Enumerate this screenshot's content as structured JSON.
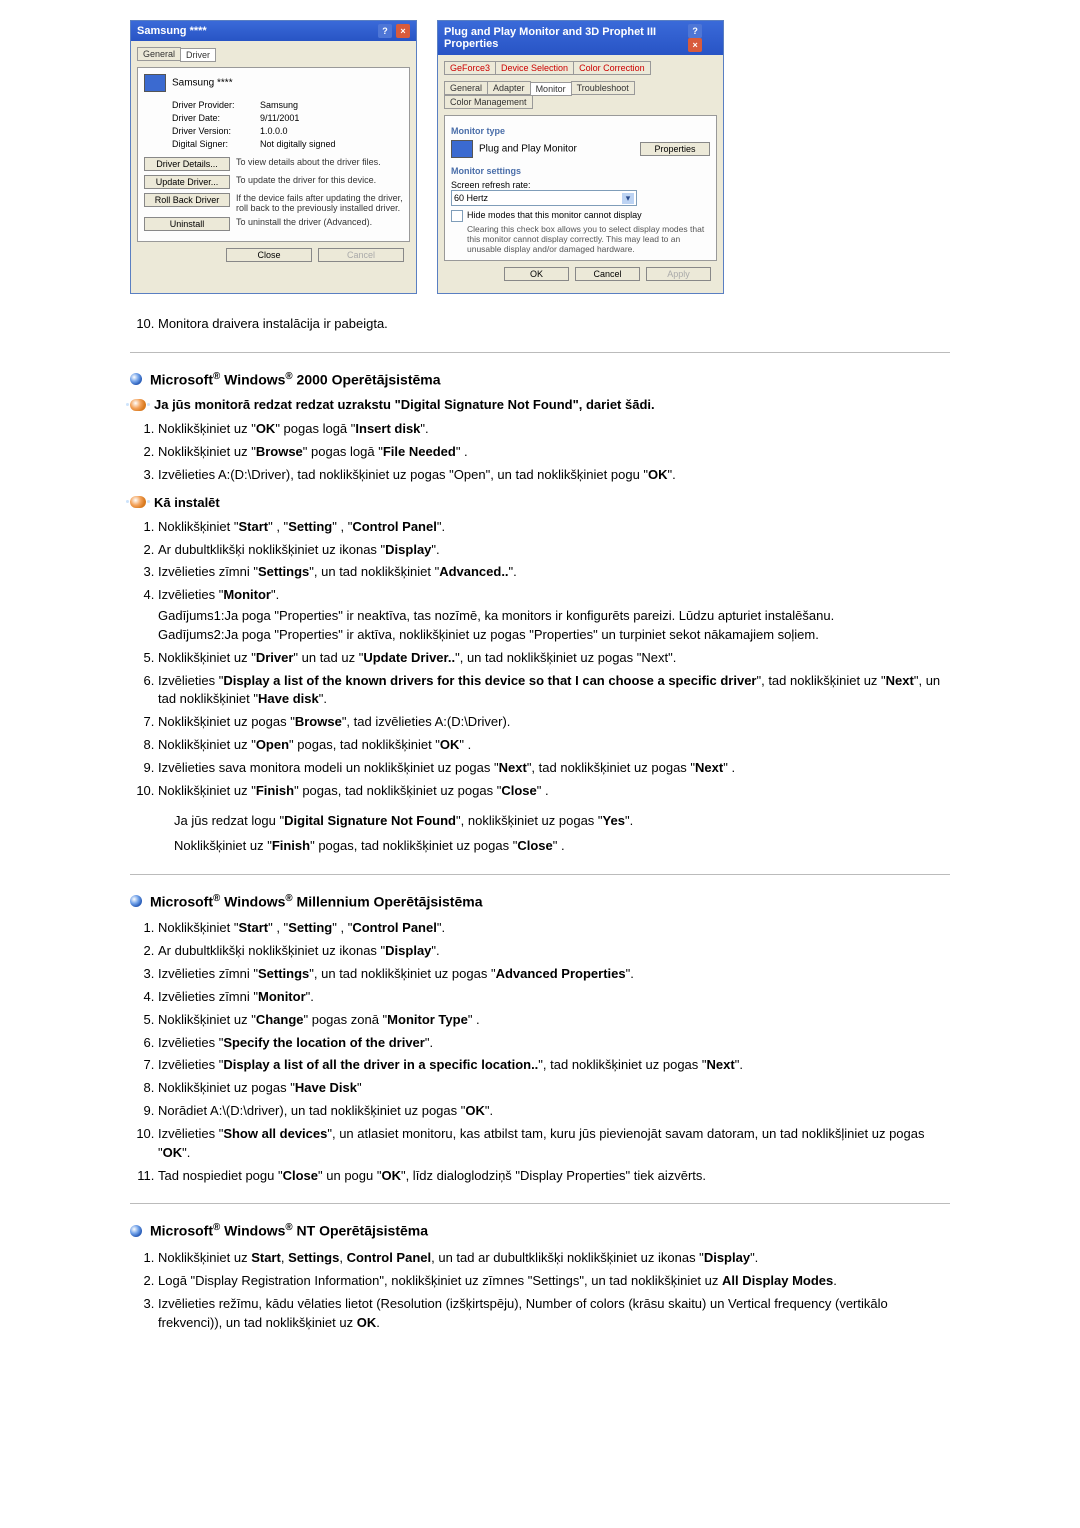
{
  "screenshots": {
    "left": {
      "title": "Samsung ****",
      "tabs": [
        "General",
        "Driver"
      ],
      "device_name": "Samsung ****",
      "provider_label": "Driver Provider:",
      "provider_value": "Samsung",
      "date_label": "Driver Date:",
      "date_value": "9/11/2001",
      "version_label": "Driver Version:",
      "version_value": "1.0.0.0",
      "signer_label": "Digital Signer:",
      "signer_value": "Not digitally signed",
      "btn_details": "Driver Details...",
      "btn_details_desc": "To view details about the driver files.",
      "btn_update": "Update Driver...",
      "btn_update_desc": "To update the driver for this device.",
      "btn_rollback": "Roll Back Driver",
      "btn_rollback_desc": "If the device fails after updating the driver, roll back to the previously installed driver.",
      "btn_uninstall": "Uninstall",
      "btn_uninstall_desc": "To uninstall the driver (Advanced).",
      "close": "Close",
      "cancel": "Cancel"
    },
    "right": {
      "title": "Plug and Play Monitor and 3D Prophet III Properties",
      "tabs_row1": [
        "GeForce3",
        "Device Selection",
        "Color Correction"
      ],
      "tabs_row2": [
        "General",
        "Adapter",
        "Monitor",
        "Troubleshoot",
        "Color Management"
      ],
      "type_label": "Monitor type",
      "type_value": "Plug and Play Monitor",
      "properties": "Properties",
      "settings_label": "Monitor settings",
      "refresh_label": "Screen refresh rate:",
      "refresh_value": "60 Hertz",
      "hide_modes": "Hide modes that this monitor cannot display",
      "hide_note": "Clearing this check box allows you to select display modes that this monitor cannot display correctly. This may lead to an unusable display and/or damaged hardware.",
      "ok": "OK",
      "cancel": "Cancel",
      "apply": "Apply"
    }
  },
  "step10_after_img": "Monitora draivera instalācija ir pabeigta.",
  "sections": {
    "win2000": {
      "heading": "Microsoft® Windows® 2000 Operētājsistēma",
      "sub1": "Ja jūs monitorā redzat redzat uzrakstu \"Digital Signature Not Found\", dariet šādi.",
      "list1": [
        "Noklikšķiniet uz \"<b>OK</b>\" pogas logā \"<b>Insert disk</b>\".",
        "Noklikšķiniet uz \"<b>Browse</b>\" pogas logā \"<b>File Needed</b>\" .",
        "Izvēlieties A:(D:\\Driver), tad noklikšķiniet uz pogas \"Open\", un tad noklikšķiniet pogu \"<b>OK</b>\"."
      ],
      "sub2": "Kā instalēt",
      "list2": [
        "Noklikšķiniet \"<b>Start</b>\" , \"<b>Setting</b>\" , \"<b>Control Panel</b>\".",
        "Ar dubultklikšķi noklikšķiniet uz ikonas \"<b>Display</b>\".",
        "Izvēlieties zīmni \"<b>Settings</b>\", un tad noklikšķiniet \"<b>Advanced..</b>\".",
        "Izvēlieties \"<b>Monitor</b>\".",
        "Noklikšķiniet uz \"<b>Driver</b>\" un tad uz \"<b>Update Driver..</b>\", un tad noklikšķiniet uz pogas \"Next\".",
        "Izvēlieties \"<b>Display a list of the known drivers for this device so that I can choose a specific driver</b>\", tad noklikšķiniet uz \"<b>Next</b>\", un tad noklikšķiniet \"<b>Have disk</b>\".",
        "Noklikšķiniet uz pogas \"<b>Browse</b>\", tad izvēlieties A:(D:\\Driver).",
        "Noklikšķiniet uz \"<b>Open</b>\" pogas, tad noklikšķiniet \"<b>OK</b>\" .",
        "Izvēlieties sava monitora modeli un noklikšķiniet uz pogas \"<b>Next</b>\", tad noklikšķiniet uz pogas \"<b>Next</b>\" .",
        "Noklikšķiniet uz \"<b>Finish</b>\" pogas, tad noklikšķiniet uz pogas \"<b>Close</b>\" ."
      ],
      "case1_label": "Gadījums1:",
      "case1_text": "Ja poga \"Properties\" ir neaktīva, tas nozīmē, ka monitors ir konfigurēts pareizi. Lūdzu apturiet instalēšanu.",
      "case2_label": "Gadījums2:",
      "case2_text": "Ja poga \"Properties\" ir aktīva, noklikšķiniet uz pogas \"Properties\" un turpiniet sekot nākamajiem soļiem.",
      "post_note1": "Ja jūs redzat logu \"<b>Digital Signature Not Found</b>\", noklikšķiniet uz pogas \"<b>Yes</b>\".",
      "post_note2": "Noklikšķiniet uz \"<b>Finish</b>\" pogas, tad noklikšķiniet uz pogas \"<b>Close</b>\" ."
    },
    "winme": {
      "heading": "Microsoft® Windows® Millennium Operētājsistēma",
      "list": [
        "Noklikšķiniet \"<b>Start</b>\" , \"<b>Setting</b>\" , \"<b>Control Panel</b>\".",
        "Ar dubultklikšķi noklikšķiniet uz ikonas \"<b>Display</b>\".",
        "Izvēlieties zīmni \"<b>Settings</b>\", un tad noklikšķiniet uz pogas \"<b>Advanced Properties</b>\".",
        "Izvēlieties zīmni \"<b>Monitor</b>\".",
        "Noklikšķiniet uz \"<b>Change</b>\" pogas zonā \"<b>Monitor Type</b>\" .",
        "Izvēlieties \"<b>Specify the location of the driver</b>\".",
        "Izvēlieties \"<b>Display a list of all the driver in a specific location..</b>\", tad noklikšķiniet uz pogas \"<b>Next</b>\".",
        "Noklikšķiniet uz pogas \"<b>Have Disk</b>\"",
        "Norādiet A:\\(D:\\driver), un tad noklikšķiniet uz pogas \"<b>OK</b>\".",
        "Izvēlieties \"<b>Show all devices</b>\", un atlasiet monitoru, kas atbilst tam, kuru jūs pievienojāt savam datoram, un tad noklikšļiniet uz pogas \"<b>OK</b>\".",
        "Tad nospiediet pogu \"<b>Close</b>\" un pogu \"<b>OK</b>\", līdz dialoglodziņš \"Display Properties\" tiek aizvērts."
      ]
    },
    "winnt": {
      "heading": "Microsoft® Windows® NT Operētājsistēma",
      "list": [
        "Noklikšķiniet uz <b>Start</b>, <b>Settings</b>, <b>Control Panel</b>, un tad ar dubultklikšķi noklikšķiniet uz ikonas \"<b>Display</b>\".",
        "Logā \"Display Registration Information\", noklikšķiniet uz zīmnes \"Settings\", un tad noklikšķiniet uz <b>All Display Modes</b>.",
        "Izvēlieties režīmu, kādu vēlaties lietot (Resolution (izšķirtspēju), Number of colors (krāsu skaitu) un Vertical frequency (vertikālo frekvenci)), un tad noklikšķiniet uz <b>OK</b>."
      ]
    }
  }
}
